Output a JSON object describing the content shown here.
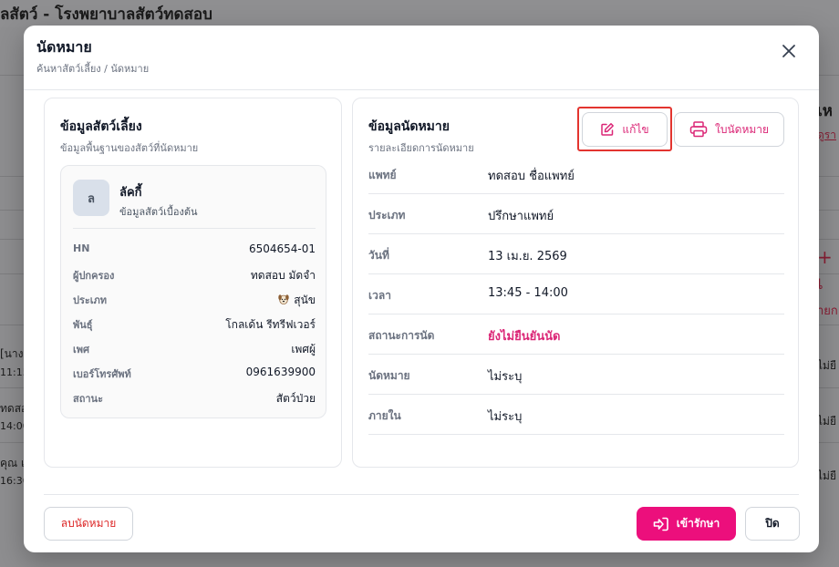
{
  "background": {
    "title": "ลสัตว์ - โรงพยาบาลสัตว์ทดสอบ",
    "right_heading": "เห",
    "right_link": "ดูรา",
    "right_plus": "+ เ",
    "right_tag": "ายก",
    "right_small": [
      "ไม่ยื",
      "ไม่ยื",
      "ไม่ยื"
    ],
    "left_items": [
      {
        "name": "[นาง",
        "time": "11:15"
      },
      {
        "name": "ทดสอ",
        "time": "14:00"
      },
      {
        "name": "คุณ เ",
        "time": "16:30"
      }
    ]
  },
  "modal": {
    "title": "นัดหมาย",
    "breadcrumb": "ค้นหาสัตว์เลี้ยง / นัดหมาย",
    "close_icon": "close-icon"
  },
  "pet": {
    "card_title": "ข้อมูลสัตว์เลี้ยง",
    "card_subtitle": "ข้อมูลพื้นฐานของสัตว์ที่นัดหมาย",
    "avatar_initial": "ล",
    "name": "ลัคกี้",
    "desc": "ข้อมูลสัตว์เบื้องต้น",
    "fields": [
      {
        "label": "HN",
        "value": "6504654-01"
      },
      {
        "label": "ผู้ปกครอง",
        "value": "ทดสอบ มัดจำ"
      },
      {
        "label": "ประเภท",
        "value": "สุนัข",
        "icon": "dog-icon"
      },
      {
        "label": "พันธุ์",
        "value": "โกลเด้น รีทรีฟเวอร์"
      },
      {
        "label": "เพศ",
        "value": "เพศผู้"
      },
      {
        "label": "เบอร์โทรศัพท์",
        "value": "0961639900"
      },
      {
        "label": "สถานะ",
        "value": "สัตว์ป่วย"
      }
    ]
  },
  "appointment": {
    "card_title": "ข้อมูลนัดหมาย",
    "card_subtitle": "รายละเอียดการนัดหมาย",
    "edit_label": "แก้ไข",
    "print_label": "ใบนัดหมาย",
    "rows": [
      {
        "label": "แพทย์",
        "value": "ทดสอบ ชื่อแพทย์"
      },
      {
        "label": "ประเภท",
        "value": "ปรึกษาแพทย์"
      },
      {
        "label": "วันที่",
        "value": "13 เม.ย. 2569"
      },
      {
        "label": "เวลา",
        "value": "13:45 - 14:00"
      },
      {
        "label": "สถานะการนัด",
        "value": "ยังไม่ยืนยันนัด",
        "highlight": true
      },
      {
        "label": "นัดหมาย",
        "value": "ไม่ระบุ"
      },
      {
        "label": "ภายใน",
        "value": "ไม่ระบุ"
      }
    ]
  },
  "footer": {
    "delete_label": "ลบนัดหมาย",
    "treat_label": "เข้ารักษา",
    "close_label": "ปิด"
  },
  "colors": {
    "accent": "#ec0f7c",
    "accent_text": "#db2777",
    "danger": "#dc2626",
    "highlight_box": "#e3342f"
  }
}
